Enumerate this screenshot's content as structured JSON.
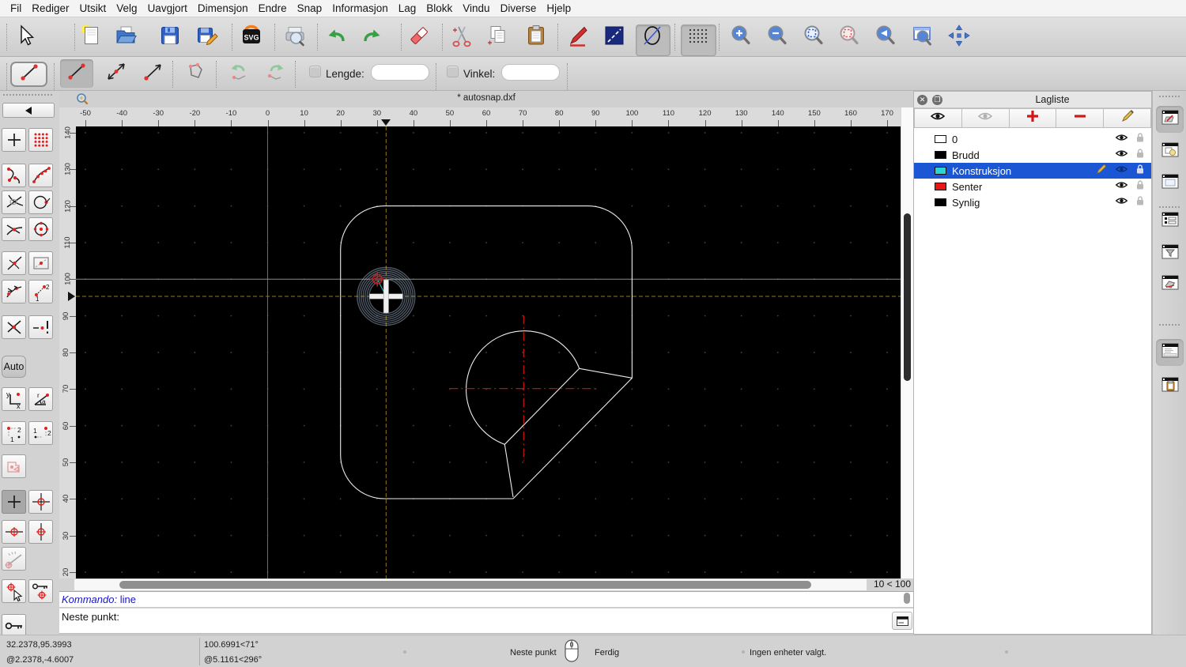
{
  "window": {
    "menu_items": [
      "Fil",
      "Rediger",
      "Utsikt",
      "Velg",
      "Uavgjort",
      "Dimensjon",
      "Endre",
      "Snap",
      "Informasjon",
      "Lag",
      "Blokk",
      "Vindu",
      "Diverse",
      "Hjelp"
    ]
  },
  "toolbar_main": {
    "icons": [
      "pointer",
      "new-file",
      "open-file",
      "save",
      "save-as",
      "svg-export",
      "print-preview",
      "undo",
      "redo",
      "delete",
      "cut",
      "copy",
      "paste",
      "pen-attributes",
      "line-attributes",
      "circle-attributes",
      "grid-toggle",
      "zoom-in",
      "zoom-out",
      "zoom-auto",
      "zoom-selected",
      "zoom-previous",
      "zoom-window",
      "zoom-pan"
    ]
  },
  "toolbar_line": {
    "current_tool_icon": "line-two-points",
    "icons": [
      "line-two-points",
      "line-bidirectional",
      "line-ray",
      "polyline",
      "undo-segment",
      "redo-segment"
    ],
    "lengde_label": "Lengde:",
    "lengde_value": "",
    "vinkel_label": "Vinkel:",
    "vinkel_value": ""
  },
  "snap_toolbar": {
    "back_icon": "back-arrow",
    "auto_label": "Auto",
    "icons": [
      "snap-free",
      "snap-grid",
      "snap-endpoints",
      "snap-on-entity",
      "snap-intersection-manual",
      "snap-point-on-circle",
      "snap-nearest",
      "snap-center",
      "snap-middle",
      "snap-distance-box",
      "snap-tangent",
      "snap-sequence",
      "snap-intersection",
      "restrict-nothing",
      "coord-cartesian",
      "coord-polar",
      "ref-point-a",
      "ref-point-b",
      "iso-view",
      "crosshair-plus",
      "crosshair-target",
      "target-hline",
      "target-vline",
      "protractor",
      "select-target",
      "key-target",
      "key-lock"
    ]
  },
  "document": {
    "title": "* autosnap.dxf",
    "h_ruler": [
      -50,
      -40,
      -30,
      -20,
      -10,
      0,
      10,
      20,
      30,
      40,
      50,
      60,
      70,
      80,
      90,
      100,
      110,
      120,
      130,
      140,
      150,
      160,
      170
    ],
    "v_ruler": [
      140,
      130,
      120,
      110,
      100,
      90,
      80,
      70,
      60,
      50,
      40,
      30,
      20
    ],
    "zoom_ratio": "10 < 100"
  },
  "layer_panel": {
    "title": "Lagliste",
    "toolbar_icons": [
      "show-all-eye",
      "hide-all-eye",
      "add-layer",
      "remove-layer",
      "edit-layer"
    ],
    "layers": [
      {
        "name": "0",
        "color": "#ffffff",
        "selected": false
      },
      {
        "name": "Brudd",
        "color": "#000000",
        "selected": false
      },
      {
        "name": "Konstruksjon",
        "color": "#2bd5d5",
        "selected": true
      },
      {
        "name": "Senter",
        "color": "#e81717",
        "selected": false
      },
      {
        "name": "Synlig",
        "color": "#000000",
        "selected": false
      }
    ]
  },
  "right_dock": {
    "icons": [
      "layer-list-window",
      "block-list-window",
      "library-browser-window",
      "entity-list-window",
      "filter-window",
      "wall-window",
      "command-window",
      "clipboard-window"
    ]
  },
  "command": {
    "history_label": "Kommando:",
    "history_value": "line",
    "prompt": "Neste punkt:"
  },
  "status": {
    "abs_coord": "32.2378,95.3993",
    "rel_coord": "@2.2378,-4.6007",
    "abs_polar": "100.6991<71°",
    "rel_polar": "@5.1161<296°",
    "left_click": "Neste punkt",
    "right_click": "Ferdig",
    "selection": "Ingen enheter valgt."
  }
}
